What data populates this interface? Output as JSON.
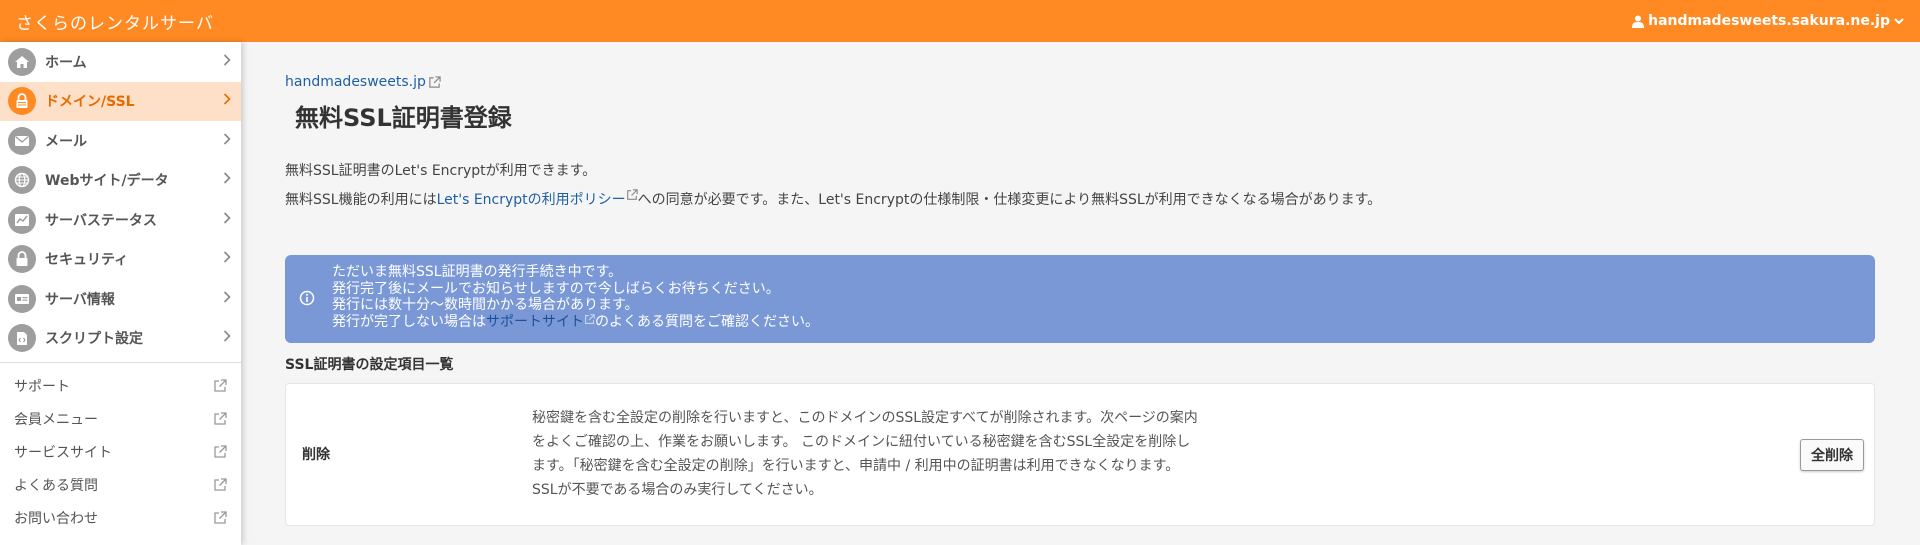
{
  "header": {
    "brand": "さくらのレンタルサーバ",
    "account": "handmadesweets.sakura.ne.jp"
  },
  "sidebar": {
    "items": [
      {
        "label": "ホーム",
        "icon": "home-icon"
      },
      {
        "label": "ドメイン/SSL",
        "icon": "lock-icon",
        "active": true
      },
      {
        "label": "メール",
        "icon": "mail-icon"
      },
      {
        "label": "Webサイト/データ",
        "icon": "globe-icon"
      },
      {
        "label": "サーバステータス",
        "icon": "chart-icon"
      },
      {
        "label": "セキュリティ",
        "icon": "padlock-icon"
      },
      {
        "label": "サーバ情報",
        "icon": "server-info-icon"
      },
      {
        "label": "スクリプト設定",
        "icon": "script-icon"
      }
    ],
    "external": [
      {
        "label": "サポート"
      },
      {
        "label": "会員メニュー"
      },
      {
        "label": "サービスサイト"
      },
      {
        "label": "よくある質問"
      },
      {
        "label": "お問い合わせ"
      }
    ]
  },
  "main": {
    "domain_link": "handmadesweets.jp",
    "title": "無料SSL証明書登録",
    "desc1": "無料SSL証明書のLet's Encryptが利用できます。",
    "desc2_pre": "無料SSL機能の利用には",
    "desc2_link": "Let's Encryptの利用ポリシー",
    "desc2_post": "への同意が必要です。また、Let's Encryptの仕様制限・仕様変更により無料SSLが利用できなくなる場合があります。",
    "notice": {
      "line1": "ただいま無料SSL証明書の発行手続き中です。",
      "line2": "発行完了後にメールでお知らせしますので今しばらくお待ちください。",
      "line3": "発行には数十分〜数時間かかる場合があります。",
      "line4_pre": "発行が完了しない場合は",
      "line4_link": "サポートサイト",
      "line4_post": "のよくある質問をご確認ください。"
    },
    "section_title": "SSL証明書の設定項目一覧",
    "row": {
      "label": "削除",
      "description": "秘密鍵を含む全設定の削除を行いますと、このドメインのSSL設定すべてが削除されます。次ページの案内をよくご確認の上、作業をお願いします。 このドメインに紐付いている秘密鍵を含むSSL全設定を削除します。「秘密鍵を含む全設定の削除」を行いますと、申請中 / 利用中の証明書は利用できなくなります。SSLが不要である場合のみ実行してください。",
      "button": "全削除"
    }
  },
  "colors": {
    "header": "#ff8a24",
    "active_bg": "#fde0c7",
    "notice_bg": "#7a98d6",
    "link": "#1f5fa6"
  }
}
